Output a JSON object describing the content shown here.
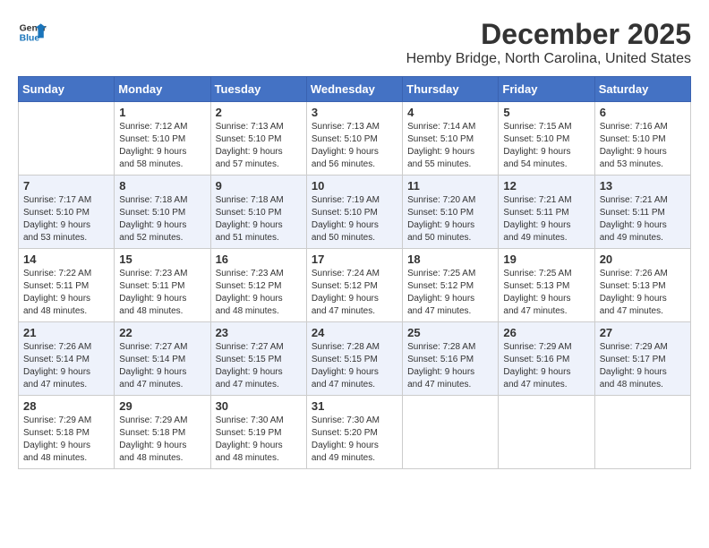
{
  "header": {
    "logo_line1": "General",
    "logo_line2": "Blue",
    "month_title": "December 2025",
    "location": "Hemby Bridge, North Carolina, United States"
  },
  "weekdays": [
    "Sunday",
    "Monday",
    "Tuesday",
    "Wednesday",
    "Thursday",
    "Friday",
    "Saturday"
  ],
  "weeks": [
    [
      {
        "day": "",
        "info": ""
      },
      {
        "day": "1",
        "info": "Sunrise: 7:12 AM\nSunset: 5:10 PM\nDaylight: 9 hours\nand 58 minutes."
      },
      {
        "day": "2",
        "info": "Sunrise: 7:13 AM\nSunset: 5:10 PM\nDaylight: 9 hours\nand 57 minutes."
      },
      {
        "day": "3",
        "info": "Sunrise: 7:13 AM\nSunset: 5:10 PM\nDaylight: 9 hours\nand 56 minutes."
      },
      {
        "day": "4",
        "info": "Sunrise: 7:14 AM\nSunset: 5:10 PM\nDaylight: 9 hours\nand 55 minutes."
      },
      {
        "day": "5",
        "info": "Sunrise: 7:15 AM\nSunset: 5:10 PM\nDaylight: 9 hours\nand 54 minutes."
      },
      {
        "day": "6",
        "info": "Sunrise: 7:16 AM\nSunset: 5:10 PM\nDaylight: 9 hours\nand 53 minutes."
      }
    ],
    [
      {
        "day": "7",
        "info": "Sunrise: 7:17 AM\nSunset: 5:10 PM\nDaylight: 9 hours\nand 53 minutes."
      },
      {
        "day": "8",
        "info": "Sunrise: 7:18 AM\nSunset: 5:10 PM\nDaylight: 9 hours\nand 52 minutes."
      },
      {
        "day": "9",
        "info": "Sunrise: 7:18 AM\nSunset: 5:10 PM\nDaylight: 9 hours\nand 51 minutes."
      },
      {
        "day": "10",
        "info": "Sunrise: 7:19 AM\nSunset: 5:10 PM\nDaylight: 9 hours\nand 50 minutes."
      },
      {
        "day": "11",
        "info": "Sunrise: 7:20 AM\nSunset: 5:10 PM\nDaylight: 9 hours\nand 50 minutes."
      },
      {
        "day": "12",
        "info": "Sunrise: 7:21 AM\nSunset: 5:11 PM\nDaylight: 9 hours\nand 49 minutes."
      },
      {
        "day": "13",
        "info": "Sunrise: 7:21 AM\nSunset: 5:11 PM\nDaylight: 9 hours\nand 49 minutes."
      }
    ],
    [
      {
        "day": "14",
        "info": "Sunrise: 7:22 AM\nSunset: 5:11 PM\nDaylight: 9 hours\nand 48 minutes."
      },
      {
        "day": "15",
        "info": "Sunrise: 7:23 AM\nSunset: 5:11 PM\nDaylight: 9 hours\nand 48 minutes."
      },
      {
        "day": "16",
        "info": "Sunrise: 7:23 AM\nSunset: 5:12 PM\nDaylight: 9 hours\nand 48 minutes."
      },
      {
        "day": "17",
        "info": "Sunrise: 7:24 AM\nSunset: 5:12 PM\nDaylight: 9 hours\nand 47 minutes."
      },
      {
        "day": "18",
        "info": "Sunrise: 7:25 AM\nSunset: 5:12 PM\nDaylight: 9 hours\nand 47 minutes."
      },
      {
        "day": "19",
        "info": "Sunrise: 7:25 AM\nSunset: 5:13 PM\nDaylight: 9 hours\nand 47 minutes."
      },
      {
        "day": "20",
        "info": "Sunrise: 7:26 AM\nSunset: 5:13 PM\nDaylight: 9 hours\nand 47 minutes."
      }
    ],
    [
      {
        "day": "21",
        "info": "Sunrise: 7:26 AM\nSunset: 5:14 PM\nDaylight: 9 hours\nand 47 minutes."
      },
      {
        "day": "22",
        "info": "Sunrise: 7:27 AM\nSunset: 5:14 PM\nDaylight: 9 hours\nand 47 minutes."
      },
      {
        "day": "23",
        "info": "Sunrise: 7:27 AM\nSunset: 5:15 PM\nDaylight: 9 hours\nand 47 minutes."
      },
      {
        "day": "24",
        "info": "Sunrise: 7:28 AM\nSunset: 5:15 PM\nDaylight: 9 hours\nand 47 minutes."
      },
      {
        "day": "25",
        "info": "Sunrise: 7:28 AM\nSunset: 5:16 PM\nDaylight: 9 hours\nand 47 minutes."
      },
      {
        "day": "26",
        "info": "Sunrise: 7:29 AM\nSunset: 5:16 PM\nDaylight: 9 hours\nand 47 minutes."
      },
      {
        "day": "27",
        "info": "Sunrise: 7:29 AM\nSunset: 5:17 PM\nDaylight: 9 hours\nand 48 minutes."
      }
    ],
    [
      {
        "day": "28",
        "info": "Sunrise: 7:29 AM\nSunset: 5:18 PM\nDaylight: 9 hours\nand 48 minutes."
      },
      {
        "day": "29",
        "info": "Sunrise: 7:29 AM\nSunset: 5:18 PM\nDaylight: 9 hours\nand 48 minutes."
      },
      {
        "day": "30",
        "info": "Sunrise: 7:30 AM\nSunset: 5:19 PM\nDaylight: 9 hours\nand 48 minutes."
      },
      {
        "day": "31",
        "info": "Sunrise: 7:30 AM\nSunset: 5:20 PM\nDaylight: 9 hours\nand 49 minutes."
      },
      {
        "day": "",
        "info": ""
      },
      {
        "day": "",
        "info": ""
      },
      {
        "day": "",
        "info": ""
      }
    ]
  ]
}
